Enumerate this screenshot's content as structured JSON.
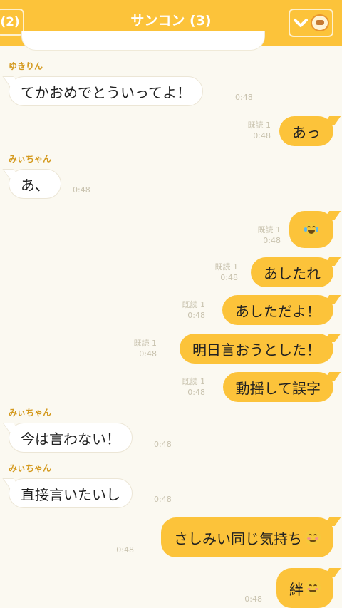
{
  "header": {
    "back_label": "(2)",
    "title": "サンコン (3)",
    "page_dots": 3,
    "active_dot": 0
  },
  "messages": [
    {
      "side": "in",
      "name": "ゆきりん",
      "text": "てかおめでとういってよ！",
      "time": "0:48"
    },
    {
      "side": "out",
      "read": "既読 1",
      "text": "あっ",
      "time": "0:48"
    },
    {
      "side": "in",
      "name": "みぃちゃん",
      "text": "あ、",
      "time": "0:48"
    },
    {
      "side": "out",
      "read": "既読 1",
      "text": "",
      "emoji": "face-with-tears-of-joy",
      "time": "0:48"
    },
    {
      "side": "out",
      "read": "既読 1",
      "text": "あしたれ",
      "time": "0:48"
    },
    {
      "side": "out",
      "read": "既読 1",
      "text": "あしただよ！",
      "time": "0:48"
    },
    {
      "side": "out",
      "read": "既読 1",
      "text": "明日言おうとした！",
      "time": "0:48"
    },
    {
      "side": "out",
      "read": "既読 1",
      "text": "動揺して誤字",
      "time": "0:48"
    },
    {
      "side": "in",
      "name": "みぃちゃん",
      "text": "今は言わない！",
      "time": "0:48"
    },
    {
      "side": "in",
      "name": "みぃちゃん",
      "text": "直接言いたいし",
      "time": "0:48"
    },
    {
      "side": "out",
      "text": "さしみい同じ気持ち",
      "emoji": "smiling-face",
      "time": "0:48"
    },
    {
      "side": "out",
      "text": "絆",
      "emoji": "smiling-face",
      "time": "0:48"
    }
  ],
  "colors": {
    "accent": "#fcc33a",
    "background": "#fbf9f1",
    "name": "#d49a1f"
  }
}
